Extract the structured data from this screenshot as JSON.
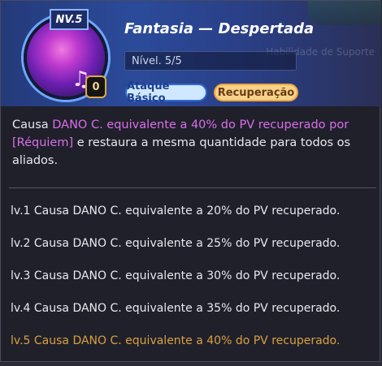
{
  "skill": {
    "level_badge": "NV.5",
    "slot_badge": "0",
    "title": "Fantasia — Despertada",
    "level_field": "Nível. 5/5",
    "tags": [
      "Ataque Básico",
      "Recuperação"
    ]
  },
  "background_faded_text": "Habilidade de Suporte",
  "description": {
    "part1": "Causa ",
    "part2": "DANO C. equivalente a 40% do PV recuperado por [Réquiem]",
    "part3": " e restaura a mesma quantidade para todos os aliados."
  },
  "levels": [
    "lv.1 Causa DANO C. equivalente a 20% do PV recuperado.",
    "lv.2 Causa DANO C. equivalente a 25% do PV recuperado.",
    "lv.3 Causa DANO C. equivalente a 30% do PV recuperado.",
    "lv.4 Causa DANO C. equivalente a 35% do PV recuperado.",
    "lv.5 Causa DANO C. equivalente a 40% do PV recuperado."
  ],
  "colors": {
    "highlight": "#d86fe8",
    "active_level": "#d8a040"
  }
}
